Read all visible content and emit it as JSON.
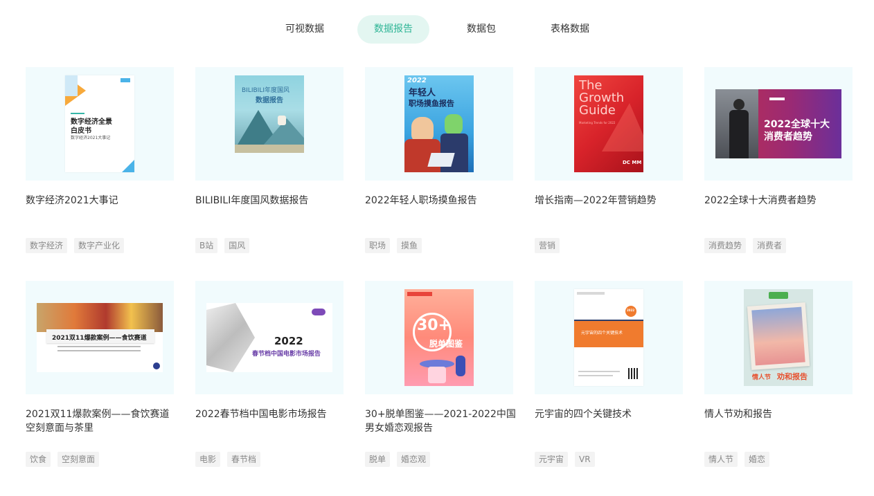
{
  "tabs": [
    {
      "label": "可视数据",
      "active": false
    },
    {
      "label": "数据报告",
      "active": true
    },
    {
      "label": "数据包",
      "active": false
    },
    {
      "label": "表格数据",
      "active": false
    }
  ],
  "colors": {
    "accent": "#2fb596",
    "accent_bg": "#e3f6f1",
    "thumb_bg": "#f1fbfd",
    "tag_bg": "#f3f3f3"
  },
  "cards": [
    {
      "title": "数字经济2021大事记",
      "tags": [
        "数字经济",
        "数字产业化"
      ],
      "cover_text": [
        "数字经济全景",
        "白皮书",
        "数字经济2021大事记"
      ]
    },
    {
      "title": "BILIBILI年度国风数据报告",
      "tags": [
        "B站",
        "国风"
      ],
      "cover_text": [
        "BILIBILI年度国风",
        "数据报告"
      ]
    },
    {
      "title": "2022年轻人职场摸鱼报告",
      "tags": [
        "职场",
        "摸鱼"
      ],
      "cover_text": [
        "2022",
        "年轻人",
        "职场摸鱼报告"
      ]
    },
    {
      "title": "增长指南—2022年营销趋势",
      "tags": [
        "营销"
      ],
      "cover_text": [
        "The",
        "Growth",
        "Guide",
        "Marketing Trends for 2022",
        "DC MM"
      ]
    },
    {
      "title": "2022全球十大消费者趋势",
      "tags": [
        "消费趋势",
        "消费者"
      ],
      "cover_text": [
        "2022全球十大",
        "消费者趋势"
      ]
    },
    {
      "title": "2021双11爆款案例——食饮赛道空刻意面与茶里",
      "tags": [
        "饮食",
        "空刻意面"
      ],
      "cover_text": [
        "2021双11爆款案例——食饮赛道"
      ]
    },
    {
      "title": "2022春节档中国电影市场报告",
      "tags": [
        "电影",
        "春节档"
      ],
      "cover_text": [
        "2022",
        "春节档中国电影市场报告"
      ]
    },
    {
      "title": "30+脱单图鉴——2021-2022中国男女婚恋观报告",
      "tags": [
        "脱单",
        "婚恋观"
      ],
      "cover_text": [
        "30+",
        "脱单图鉴"
      ]
    },
    {
      "title": "元宇宙的四个关键技术",
      "tags": [
        "元宇宙",
        "VR"
      ],
      "cover_text": [
        "元宇宙的四个关键技术",
        "2022"
      ]
    },
    {
      "title": "情人节劝和报告",
      "tags": [
        "情人节",
        "婚恋"
      ],
      "cover_text": [
        "情人节",
        "劝和报告"
      ]
    }
  ]
}
